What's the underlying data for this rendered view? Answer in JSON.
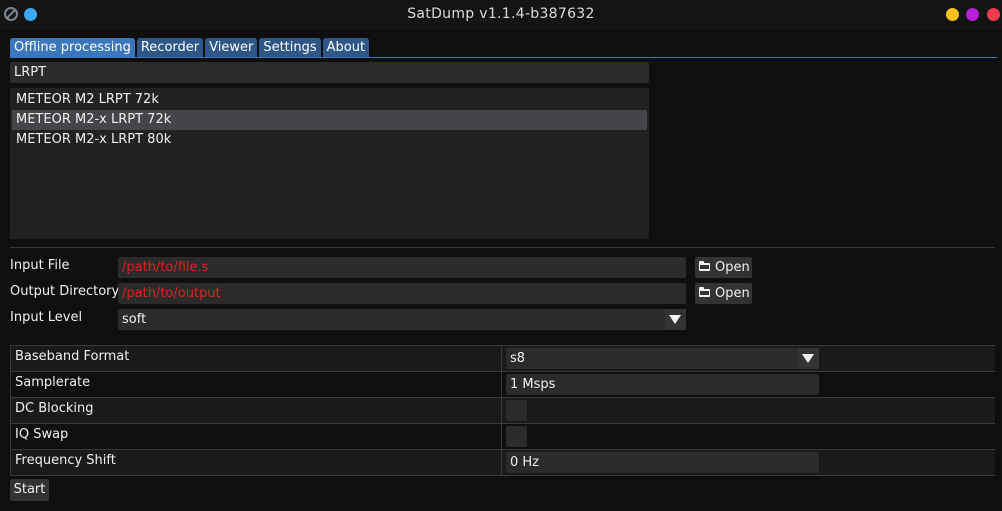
{
  "window": {
    "title": "SatDump v1.1.4-b387632"
  },
  "tabs": [
    {
      "label": "Offline processing",
      "active": true
    },
    {
      "label": "Recorder",
      "active": false
    },
    {
      "label": "Viewer",
      "active": false
    },
    {
      "label": "Settings",
      "active": false
    },
    {
      "label": "About",
      "active": false
    }
  ],
  "pipeline_search": {
    "value": "LRPT"
  },
  "pipelines": [
    {
      "label": "METEOR M2 LRPT 72k",
      "selected": false
    },
    {
      "label": "METEOR M2-x LRPT 72k",
      "selected": true
    },
    {
      "label": "METEOR M2-x LRPT 80k",
      "selected": false
    }
  ],
  "form": {
    "input_file": {
      "label": "Input File",
      "value": "/path/to/file.s",
      "button": "Open"
    },
    "output_directory": {
      "label": "Output Directory",
      "value": "/path/to/output",
      "button": "Open"
    },
    "input_level": {
      "label": "Input Level",
      "value": "soft"
    }
  },
  "parameters": {
    "baseband_format": {
      "label": "Baseband Format",
      "value": "s8"
    },
    "samplerate": {
      "label": "Samplerate",
      "value": "1 Msps"
    },
    "dc_blocking": {
      "label": "DC Blocking",
      "checked": false
    },
    "iq_swap": {
      "label": "IQ Swap",
      "checked": false
    },
    "frequency_shift": {
      "label": "Frequency Shift",
      "value": "0 Hz"
    }
  },
  "start_button": "Start",
  "colors": {
    "tab_active": "#3b76bd",
    "tab_inactive": "#2e5788",
    "path_text": "#d9241e",
    "minimize": "#f6c01f",
    "maximize": "#b71fd9",
    "close": "#ef3b4e",
    "pin": "#3fa7f0"
  },
  "icons": {
    "app": "satdump-app-icon",
    "pin": "pin-icon",
    "folder": "folder-icon",
    "dropdown": "chevron-down-icon"
  }
}
